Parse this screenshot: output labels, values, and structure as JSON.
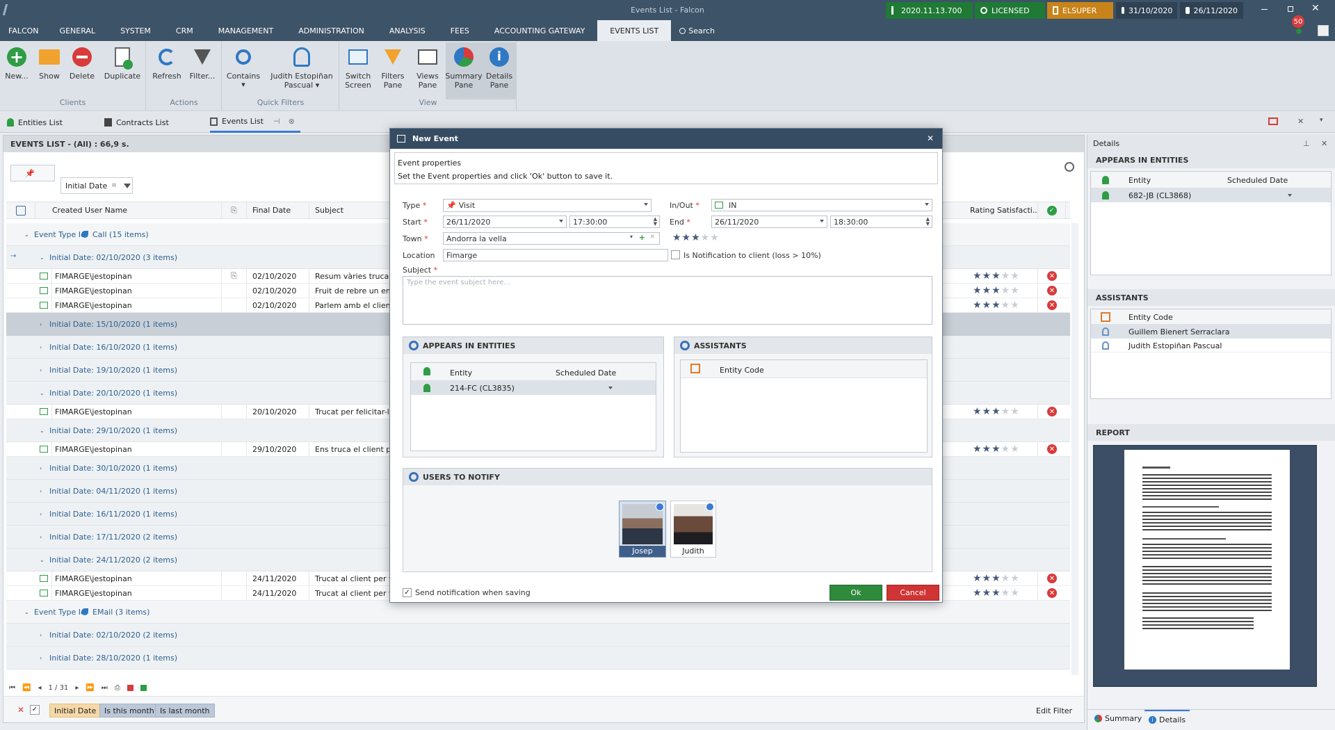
{
  "window": {
    "title": "Events List - Falcon"
  },
  "status": {
    "version": "2020.11.13.700",
    "license": "LICENSED",
    "user": "ELSUPER",
    "locked_date": "31/10/2020",
    "current_date": "26/11/2020",
    "notifications": "50"
  },
  "menu": [
    "FALCON",
    "GENERAL",
    "SYSTEM",
    "CRM",
    "MANAGEMENT",
    "ADMINISTRATION",
    "ANALYSIS",
    "FEES",
    "ACCOUNTING GATEWAY",
    "EVENTS LIST"
  ],
  "search_label": "Search",
  "ribbon": {
    "groups": {
      "clients": "Clients",
      "actions": "Actions",
      "quick_filters": "Quick Filters",
      "view": "View"
    },
    "new": "New...",
    "show": "Show",
    "delete": "Delete",
    "duplicate": "Duplicate",
    "refresh": "Refresh",
    "filter": "Filter...",
    "contains": "Contains",
    "qf_user_1": "Judith Estopiñan",
    "qf_user_2": "Pascual",
    "switch_1": "Switch",
    "switch_2": "Screen",
    "filters_1": "Filters",
    "filters_2": "Pane",
    "views_1": "Views",
    "views_2": "Pane",
    "summary_1": "Summary",
    "summary_2": "Pane",
    "details_1": "Details",
    "details_2": "Pane"
  },
  "doctabs": [
    "Entities List",
    "Contracts List",
    "Events List"
  ],
  "grid": {
    "header": "EVENTS LIST - (All) : 66,9 s.",
    "filter_chip": "Initial Date",
    "columns": {
      "created_user": "Created User Name",
      "final_date": "Final Date",
      "subject": "Subject",
      "rating": "Rating Satisfacti..."
    },
    "rows": [
      {
        "kind": "type",
        "text": "Event Type Id:",
        "value": "Call (15 items)"
      },
      {
        "kind": "group",
        "text": "Initial Date: 02/10/2020 (3 items)"
      },
      {
        "kind": "data",
        "user": "FIMARGE\\jestopinan",
        "date": "02/10/2020",
        "subject": "Resum vàries trucades",
        "stars": 3,
        "clip": true
      },
      {
        "kind": "data",
        "user": "FIMARGE\\jestopinan",
        "date": "02/10/2020",
        "subject": "Fruit de rebre un email",
        "stars": 3
      },
      {
        "kind": "data",
        "user": "FIMARGE\\jestopinan",
        "date": "02/10/2020",
        "subject": "Parlem amb el client, M",
        "stars": 3
      },
      {
        "kind": "groupsel",
        "text": "Initial Date: 15/10/2020 (1 items)"
      },
      {
        "kind": "group",
        "text": "Initial Date: 16/10/2020 (1 items)"
      },
      {
        "kind": "group",
        "text": "Initial Date: 19/10/2020 (1 items)"
      },
      {
        "kind": "group",
        "text": "Initial Date: 20/10/2020 (1 items)"
      },
      {
        "kind": "data",
        "user": "FIMARGE\\jestopinan",
        "date": "20/10/2020",
        "subject": "Trucat per felicitar-lo p",
        "stars": 3
      },
      {
        "kind": "group",
        "text": "Initial Date: 29/10/2020 (1 items)"
      },
      {
        "kind": "data",
        "user": "FIMARGE\\jestopinan",
        "date": "29/10/2020",
        "subject": "Ens truca el client per",
        "stars": 3
      },
      {
        "kind": "group",
        "text": "Initial Date: 30/10/2020 (1 items)"
      },
      {
        "kind": "group",
        "text": "Initial Date: 04/11/2020 (1 items)"
      },
      {
        "kind": "group",
        "text": "Initial Date: 16/11/2020 (1 items)"
      },
      {
        "kind": "group",
        "text": "Initial Date: 17/11/2020 (2 items)"
      },
      {
        "kind": "group",
        "text": "Initial Date: 24/11/2020 (2 items)"
      },
      {
        "kind": "data",
        "user": "FIMARGE\\jestopinan",
        "date": "24/11/2020",
        "subject": "Trucat al client per veu",
        "stars": 3
      },
      {
        "kind": "data",
        "user": "FIMARGE\\jestopinan",
        "date": "24/11/2020",
        "subject": "Trucat al client per veu",
        "stars": 3
      },
      {
        "kind": "type",
        "text": "Event Type Id:",
        "value": "EMail (3 items)"
      },
      {
        "kind": "group",
        "text": "Initial Date: 02/10/2020 (2 items)"
      },
      {
        "kind": "group",
        "text": "Initial Date: 28/10/2020 (1 items)"
      }
    ],
    "pager": "1 / 31",
    "filter_tags": [
      "Initial Date",
      "Is this month",
      "Is last month"
    ],
    "edit_filter": "Edit Filter"
  },
  "details": {
    "title": "Details",
    "appears_title": "APPEARS IN ENTITIES",
    "col_entity": "Entity",
    "col_scheduled": "Scheduled Date",
    "entity_row": "682-JB  (CL3868)",
    "assistants_title": "ASSISTANTS",
    "col_entity_code": "Entity Code",
    "assistants": [
      "Guillem Bienert Serraclara",
      "Judith Estopiñan Pascual"
    ],
    "report_title": "REPORT",
    "bottom_tabs": [
      "Summary",
      "Details"
    ]
  },
  "dialog": {
    "title": "New Event",
    "intro_title": "Event properties",
    "intro_text": "Set the Event properties and click 'Ok' button to save it.",
    "type_label": "Type",
    "type_value": "Visit",
    "inout_label": "In/Out",
    "inout_value": "IN",
    "start_label": "Start",
    "start_date": "26/11/2020",
    "start_time": "17:30:00",
    "end_label": "End",
    "end_date": "26/11/2020",
    "end_time": "18:30:00",
    "town_label": "Town",
    "town_value": "Andorra la vella",
    "location_label": "Location",
    "location_value": "Fimarge",
    "notify_client_label": "Is Notification to client (loss > 10%)",
    "subject_label": "Subject",
    "subject_placeholder": "Type the event subject here...",
    "appears_title": "APPEARS IN ENTITIES",
    "col_entity": "Entity",
    "col_scheduled": "Scheduled Date",
    "entity_row": "214-FC  (CL3835)",
    "assistants_title": "ASSISTANTS",
    "col_entity_code": "Entity Code",
    "users_title": "USERS TO NOTIFY",
    "users": [
      "Josep",
      "Judith"
    ],
    "send_notification": "Send notification when saving",
    "ok": "Ok",
    "cancel": "Cancel"
  },
  "colors": {
    "titlebar": "#3c5368",
    "license_green": "#1f7a35",
    "user_orange": "#c8841a",
    "ok_green": "#2f8a3c",
    "cancel_red": "#d03434",
    "accent_blue": "#3a7bd5"
  }
}
